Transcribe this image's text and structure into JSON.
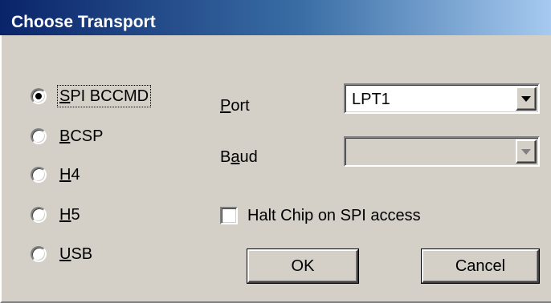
{
  "window": {
    "title": "Choose Transport"
  },
  "transports": [
    {
      "label": "SPI BCCMD",
      "selected": true
    },
    {
      "label": "BCSP",
      "selected": false
    },
    {
      "label": "H4",
      "selected": false
    },
    {
      "label": "H5",
      "selected": false
    },
    {
      "label": "USB",
      "selected": false
    }
  ],
  "port": {
    "label_first": "P",
    "label_rest": "ort",
    "value": "LPT1"
  },
  "baud": {
    "label_first": "B",
    "label_u": "a",
    "label_rest": "ud",
    "value": ""
  },
  "halt_chip": {
    "label": "Halt Chip on SPI access",
    "checked": false
  },
  "buttons": {
    "ok": "OK",
    "cancel": "Cancel"
  }
}
